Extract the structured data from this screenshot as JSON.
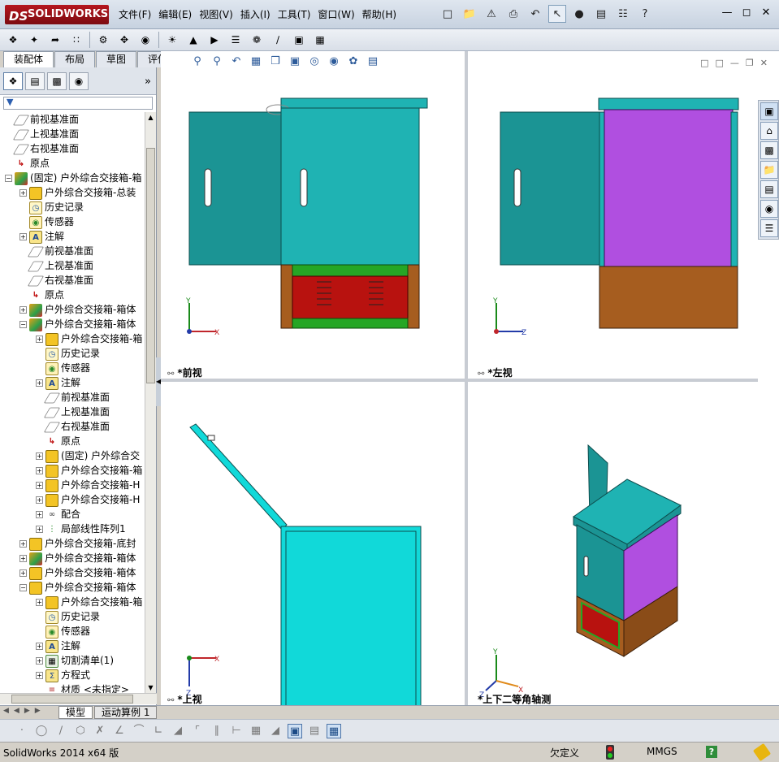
{
  "app": {
    "logo_text": "SOLIDWORKS",
    "logo_mark": "DS"
  },
  "menu": [
    "文件(F)",
    "编辑(E)",
    "视图(V)",
    "插入(I)",
    "工具(T)",
    "窗口(W)",
    "帮助(H)"
  ],
  "command_tabs": [
    "装配体",
    "布局",
    "草图",
    "评估"
  ],
  "tree": [
    {
      "label": "前视基准面",
      "icon": "plane",
      "indent": 0,
      "expand": ""
    },
    {
      "label": "上视基准面",
      "icon": "plane",
      "indent": 0,
      "expand": ""
    },
    {
      "label": "右视基准面",
      "icon": "plane",
      "indent": 0,
      "expand": ""
    },
    {
      "label": "原点",
      "icon": "origin",
      "indent": 0,
      "expand": ""
    },
    {
      "label": "(固定) 户外综合交接箱-箱",
      "icon": "asm",
      "indent": 0,
      "expand": "-"
    },
    {
      "label": "户外综合交接箱-总装",
      "icon": "part",
      "indent": 1,
      "expand": "+"
    },
    {
      "label": "历史记录",
      "icon": "hist",
      "indent": 1,
      "expand": ""
    },
    {
      "label": "传感器",
      "icon": "sensor",
      "indent": 1,
      "expand": ""
    },
    {
      "label": "注解",
      "icon": "note",
      "indent": 1,
      "expand": "+"
    },
    {
      "label": "前视基准面",
      "icon": "plane",
      "indent": 1,
      "expand": ""
    },
    {
      "label": "上视基准面",
      "icon": "plane",
      "indent": 1,
      "expand": ""
    },
    {
      "label": "右视基准面",
      "icon": "plane",
      "indent": 1,
      "expand": ""
    },
    {
      "label": "原点",
      "icon": "origin",
      "indent": 1,
      "expand": ""
    },
    {
      "label": "户外综合交接箱-箱体",
      "icon": "asm",
      "indent": 1,
      "expand": "+"
    },
    {
      "label": "户外综合交接箱-箱体",
      "icon": "asm",
      "indent": 1,
      "expand": "-"
    },
    {
      "label": "户外综合交接箱-箱",
      "icon": "part",
      "indent": 2,
      "expand": "+"
    },
    {
      "label": "历史记录",
      "icon": "hist",
      "indent": 2,
      "expand": ""
    },
    {
      "label": "传感器",
      "icon": "sensor",
      "indent": 2,
      "expand": ""
    },
    {
      "label": "注解",
      "icon": "note",
      "indent": 2,
      "expand": "+"
    },
    {
      "label": "前视基准面",
      "icon": "plane",
      "indent": 2,
      "expand": ""
    },
    {
      "label": "上视基准面",
      "icon": "plane",
      "indent": 2,
      "expand": ""
    },
    {
      "label": "右视基准面",
      "icon": "plane",
      "indent": 2,
      "expand": ""
    },
    {
      "label": "原点",
      "icon": "origin",
      "indent": 2,
      "expand": ""
    },
    {
      "label": "(固定) 户外综合交",
      "icon": "part",
      "indent": 2,
      "expand": "+"
    },
    {
      "label": "户外综合交接箱-箱",
      "icon": "part",
      "indent": 2,
      "expand": "+"
    },
    {
      "label": "户外综合交接箱-H",
      "icon": "part",
      "indent": 2,
      "expand": "+"
    },
    {
      "label": "户外综合交接箱-H",
      "icon": "part",
      "indent": 2,
      "expand": "+"
    },
    {
      "label": "配合",
      "icon": "mate",
      "indent": 2,
      "expand": "+"
    },
    {
      "label": "局部线性阵列1",
      "icon": "pattern",
      "indent": 2,
      "expand": "+"
    },
    {
      "label": "户外综合交接箱-底封",
      "icon": "part",
      "indent": 1,
      "expand": "+"
    },
    {
      "label": "户外综合交接箱-箱体",
      "icon": "asm",
      "indent": 1,
      "expand": "+"
    },
    {
      "label": "户外综合交接箱-箱体",
      "icon": "part",
      "indent": 1,
      "expand": "+"
    },
    {
      "label": "户外综合交接箱-箱体",
      "icon": "part",
      "indent": 1,
      "expand": "-"
    },
    {
      "label": "户外综合交接箱-箱",
      "icon": "part",
      "indent": 2,
      "expand": "+"
    },
    {
      "label": "历史记录",
      "icon": "hist",
      "indent": 2,
      "expand": ""
    },
    {
      "label": "传感器",
      "icon": "sensor",
      "indent": 2,
      "expand": ""
    },
    {
      "label": "注解",
      "icon": "note",
      "indent": 2,
      "expand": "+"
    },
    {
      "label": "切割清单(1)",
      "icon": "cut",
      "indent": 2,
      "expand": "+"
    },
    {
      "label": "方程式",
      "icon": "eq",
      "indent": 2,
      "expand": "+"
    },
    {
      "label": "材质 <未指定>",
      "icon": "mat",
      "indent": 2,
      "expand": ""
    }
  ],
  "bottom_tabs": [
    "模型",
    "运动算例 1"
  ],
  "viewports": {
    "front": "*前视",
    "left": "*左视",
    "top": "*上视",
    "iso": "*上下二等角轴测"
  },
  "axes": {
    "x": "X",
    "y": "Y",
    "z": "Z"
  },
  "status": {
    "app_version": "SolidWorks 2014 x64 版",
    "definition": "欠定义",
    "units": "MMGS",
    "help": "?"
  },
  "colors": {
    "door": "#1b9494",
    "body": "#1fb3b3",
    "top_view": "#11d9d9",
    "side_panel": "#b04fe0",
    "base_wood": "#a65d1f",
    "base_red": "#b8120f",
    "base_green": "#25a625"
  }
}
